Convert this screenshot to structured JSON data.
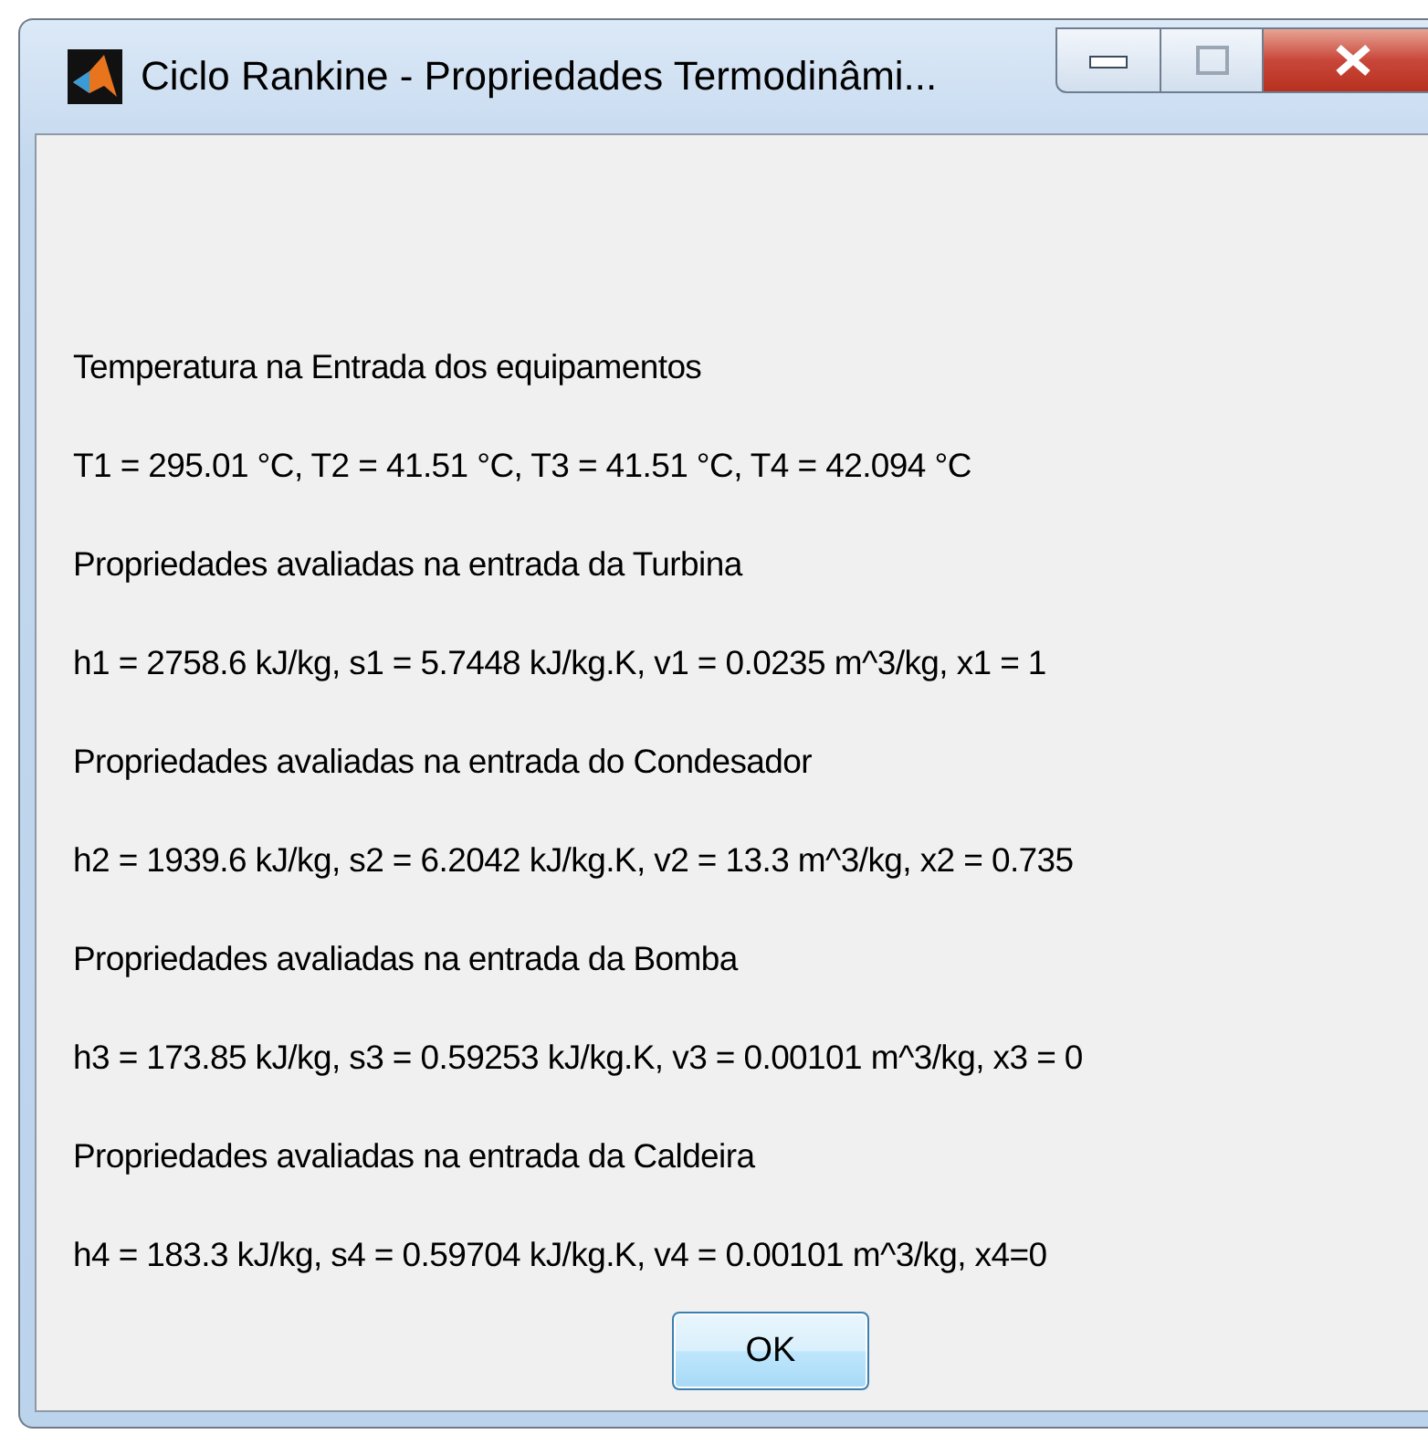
{
  "window": {
    "title": "Ciclo Rankine - Propriedades Termodinâmi..."
  },
  "lines": [
    "Temperatura na Entrada dos equipamentos",
    "T1 = 295.01 °C, T2 = 41.51 °C, T3 = 41.51 °C, T4 = 42.094 °C",
    "Propriedades avaliadas na entrada da Turbina",
    "h1 = 2758.6 kJ/kg, s1 = 5.7448 kJ/kg.K, v1 = 0.0235 m^3/kg, x1 = 1",
    "Propriedades avaliadas na entrada do Condesador",
    "h2 = 1939.6 kJ/kg, s2 = 6.2042 kJ/kg.K, v2 = 13.3 m^3/kg, x2 = 0.735",
    "Propriedades avaliadas na entrada da Bomba",
    "h3 = 173.85 kJ/kg, s3 = 0.59253 kJ/kg.K, v3 = 0.00101 m^3/kg, x3 = 0",
    "Propriedades avaliadas na entrada da Caldeira",
    "h4 = 183.3 kJ/kg, s4 = 0.59704 kJ/kg.K, v4 = 0.00101 m^3/kg, x4=0"
  ],
  "buttons": [
    "OK"
  ]
}
